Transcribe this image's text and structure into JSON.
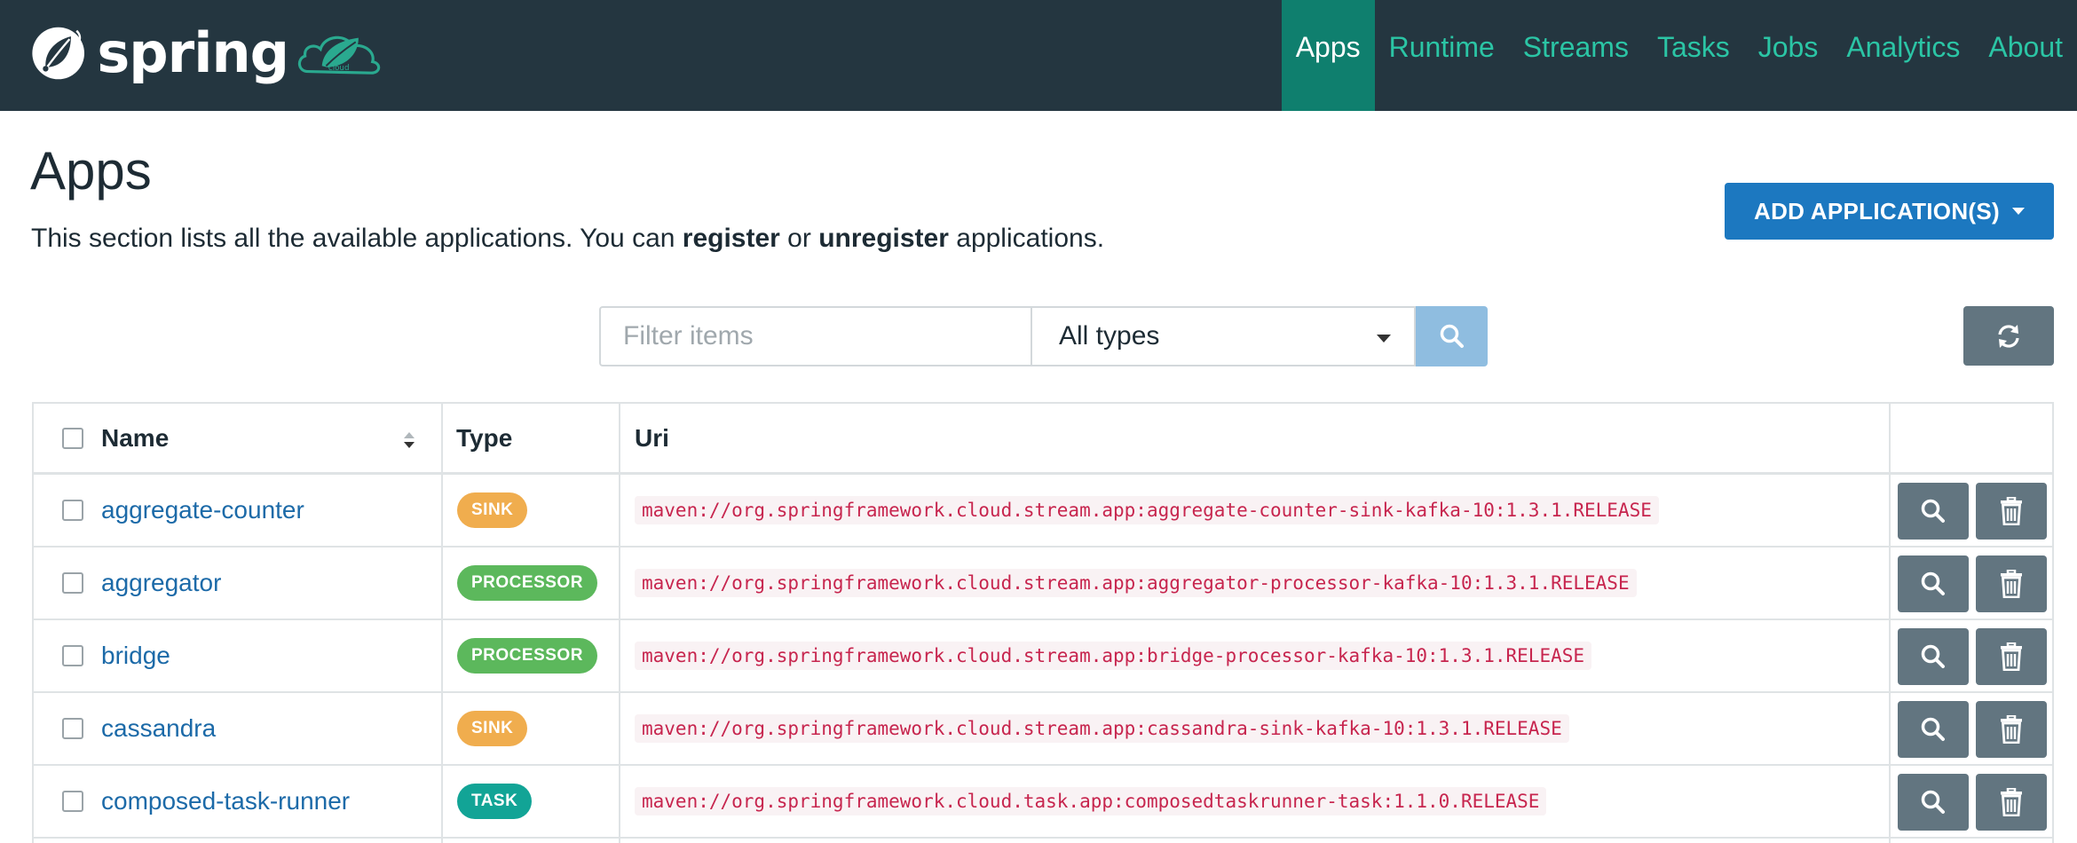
{
  "brand": {
    "name": "spring",
    "cloud_text": "cloud"
  },
  "nav": {
    "items": [
      {
        "label": "Apps",
        "active": true
      },
      {
        "label": "Runtime",
        "active": false
      },
      {
        "label": "Streams",
        "active": false
      },
      {
        "label": "Tasks",
        "active": false
      },
      {
        "label": "Jobs",
        "active": false
      },
      {
        "label": "Analytics",
        "active": false
      },
      {
        "label": "About",
        "active": false
      }
    ]
  },
  "header": {
    "title": "Apps",
    "desc_prefix": "This section lists all the available applications. You can ",
    "desc_register": "register",
    "desc_or": " or ",
    "desc_unregister": "unregister",
    "desc_suffix": " applications.",
    "add_button": "ADD APPLICATION(S)"
  },
  "filter": {
    "placeholder": "Filter items",
    "type_selected": "All types"
  },
  "table": {
    "columns": {
      "name": "Name",
      "type": "Type",
      "uri": "Uri"
    },
    "rows": [
      {
        "name": "aggregate-counter",
        "type": "SINK",
        "uri": "maven://org.springframework.cloud.stream.app:aggregate-counter-sink-kafka-10:1.3.1.RELEASE"
      },
      {
        "name": "aggregator",
        "type": "PROCESSOR",
        "uri": "maven://org.springframework.cloud.stream.app:aggregator-processor-kafka-10:1.3.1.RELEASE"
      },
      {
        "name": "bridge",
        "type": "PROCESSOR",
        "uri": "maven://org.springframework.cloud.stream.app:bridge-processor-kafka-10:1.3.1.RELEASE"
      },
      {
        "name": "cassandra",
        "type": "SINK",
        "uri": "maven://org.springframework.cloud.stream.app:cassandra-sink-kafka-10:1.3.1.RELEASE"
      },
      {
        "name": "composed-task-runner",
        "type": "TASK",
        "uri": "maven://org.springframework.cloud.task.app:composedtaskrunner-task:1.1.0.RELEASE"
      }
    ]
  },
  "colors": {
    "navbar": "#243640",
    "nav_active": "#0f7f6e",
    "nav_link": "#2bc5a5",
    "primary": "#1c78c0",
    "sink": "#f0ad4e",
    "processor": "#5cb85c",
    "task": "#12a496",
    "action": "#627580"
  }
}
